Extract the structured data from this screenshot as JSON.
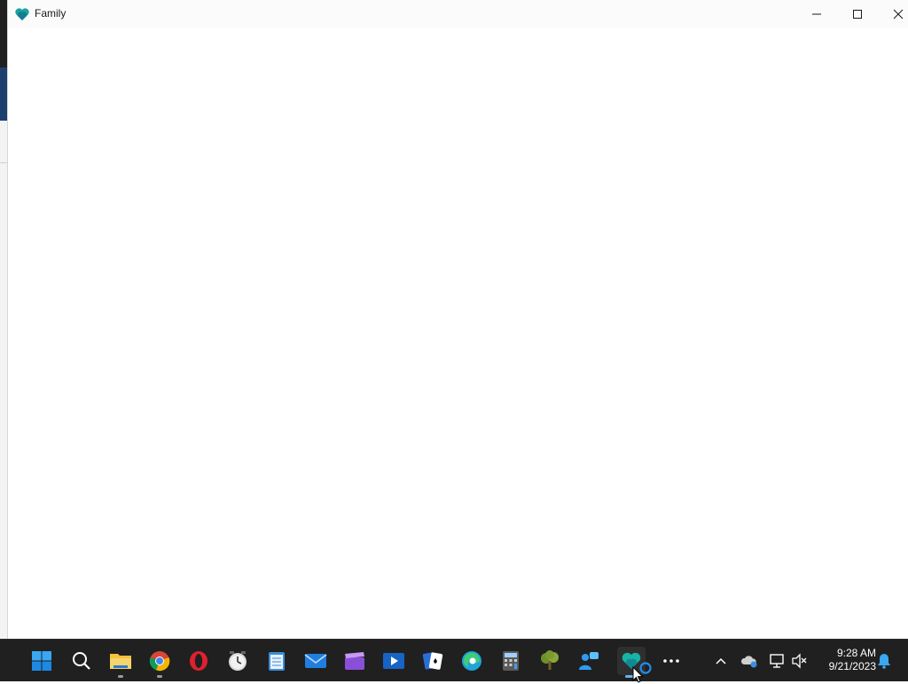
{
  "window": {
    "title": "Family",
    "controls": {
      "minimize": "minimize-icon",
      "maximize": "maximize-icon",
      "close": "close-icon"
    }
  },
  "taskbar": {
    "pinned": [
      {
        "name": "start-button",
        "icon": "windows-logo-icon"
      },
      {
        "name": "search-button",
        "icon": "search-icon"
      },
      {
        "name": "file-explorer",
        "icon": "folder-icon"
      },
      {
        "name": "chrome",
        "icon": "chrome-icon"
      },
      {
        "name": "opera",
        "icon": "opera-icon"
      },
      {
        "name": "clock-app",
        "icon": "alarm-clock-icon"
      },
      {
        "name": "notepad",
        "icon": "notepad-icon"
      },
      {
        "name": "mail",
        "icon": "mail-icon"
      },
      {
        "name": "video-editor",
        "icon": "clapperboard-icon"
      },
      {
        "name": "media-player",
        "icon": "media-player-icon"
      },
      {
        "name": "solitaire",
        "icon": "cards-icon"
      },
      {
        "name": "edge",
        "icon": "edge-icon"
      },
      {
        "name": "calculator",
        "icon": "calculator-icon"
      },
      {
        "name": "tree-app",
        "icon": "tree-icon"
      },
      {
        "name": "quick-assist",
        "icon": "quick-assist-icon"
      },
      {
        "name": "family",
        "icon": "family-heart-icon",
        "active": true
      },
      {
        "name": "more-apps",
        "icon": "more-icon"
      }
    ],
    "tray": {
      "icons": [
        "chevron-up-icon",
        "onedrive-icon",
        "network-icon",
        "volume-muted-icon"
      ],
      "time": "9:28 AM",
      "date": "9/21/2023",
      "notification": "bell-icon"
    },
    "colors": {
      "background": "#202020",
      "active_indicator": "#62b3f0"
    }
  }
}
